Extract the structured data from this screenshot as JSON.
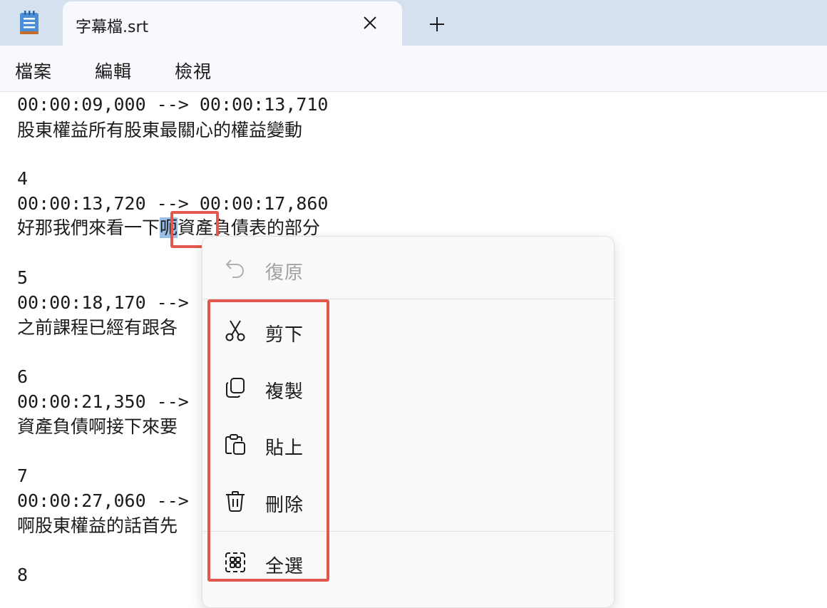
{
  "tab": {
    "title": "字幕檔.srt"
  },
  "menu": {
    "file": "檔案",
    "edit": "編輯",
    "view": "檢視"
  },
  "editor": {
    "lines": [
      "00:00:09,000 --> 00:00:13,710",
      "股東權益所有股東最關心的權益變動",
      "",
      "4",
      "00:00:13,720 --> 00:00:17,860",
      "",
      "",
      "5",
      "00:00:18,170 -->",
      "之前課程已經有跟各",
      "",
      "6",
      "00:00:21,350 -->",
      "資產負債啊接下來要",
      "",
      "7",
      "00:00:27,060 -->",
      "啊股東權益的話首先",
      "",
      "8"
    ],
    "selected_line": {
      "before": "好那我們來看一下",
      "selected": "呃",
      "after": "資產負債表的部分"
    }
  },
  "context_menu": {
    "items": [
      {
        "label": "復原",
        "icon": "undo-icon",
        "enabled": false
      },
      {
        "label": "剪下",
        "icon": "scissors-icon",
        "enabled": true
      },
      {
        "label": "複製",
        "icon": "copy-icon",
        "enabled": true
      },
      {
        "label": "貼上",
        "icon": "paste-icon",
        "enabled": true
      },
      {
        "label": "刪除",
        "icon": "trash-icon",
        "enabled": true
      },
      {
        "label": "全選",
        "icon": "select-all-icon",
        "enabled": true
      }
    ]
  },
  "colors": {
    "titlebar": "#d5e1ef",
    "selection": "#99bfe9",
    "annotation": "#e3584e"
  }
}
